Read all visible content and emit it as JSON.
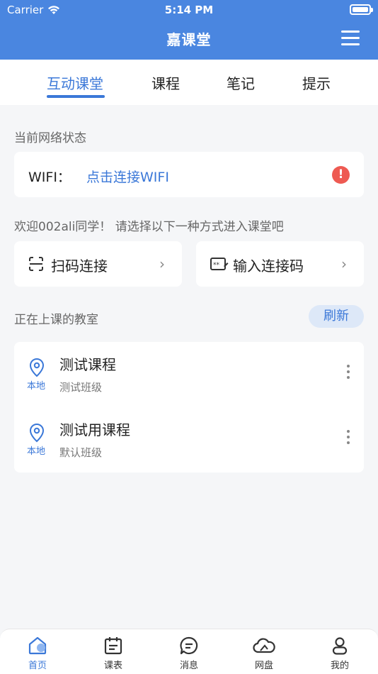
{
  "status_bar": {
    "carrier": "Carrier",
    "time": "5:14 PM"
  },
  "nav": {
    "title": "嘉课堂"
  },
  "tabs": [
    {
      "label": "互动课堂",
      "active": true
    },
    {
      "label": "课程",
      "active": false
    },
    {
      "label": "笔记",
      "active": false
    },
    {
      "label": "提示",
      "active": false
    }
  ],
  "network": {
    "section_label": "当前网络状态",
    "wifi_label": "WIFI：",
    "wifi_link": "点击连接WIFI",
    "alert_symbol": "!"
  },
  "welcome": {
    "text": "欢迎002ali同学！ 请选择以下一种方式进入课堂吧",
    "options": [
      {
        "label": "扫码连接",
        "icon": "scan-icon"
      },
      {
        "label": "输入连接码",
        "icon": "code-input-icon"
      }
    ]
  },
  "classes": {
    "section_label": "正在上课的教室",
    "refresh_label": "刷新",
    "items": [
      {
        "location": "本地",
        "title": "测试课程",
        "subtitle": "测试班级"
      },
      {
        "location": "本地",
        "title": "测试用课程",
        "subtitle": "默认班级"
      }
    ]
  },
  "tabbar": [
    {
      "label": "首页",
      "icon": "home-icon",
      "active": true
    },
    {
      "label": "课表",
      "icon": "calendar-icon",
      "active": false
    },
    {
      "label": "消息",
      "icon": "message-icon",
      "active": false
    },
    {
      "label": "网盘",
      "icon": "cloud-icon",
      "active": false
    },
    {
      "label": "我的",
      "icon": "profile-icon",
      "active": false
    }
  ],
  "colors": {
    "primary": "#4a86e0",
    "accent": "#3b78d8",
    "alert": "#ee5a52",
    "background": "#f5f6f8"
  }
}
